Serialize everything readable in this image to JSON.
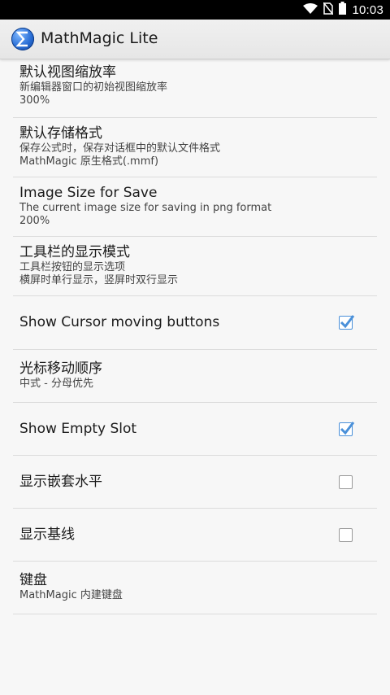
{
  "status_bar": {
    "time": "10:03",
    "icons": [
      "wifi-icon",
      "no-sim-icon",
      "battery-icon"
    ]
  },
  "app_bar": {
    "title": "MathMagic Lite",
    "icon": "sigma-app-icon"
  },
  "settings": [
    {
      "title": "默认视图缩放率",
      "summary": "新编辑器窗口的初始视图缩放率",
      "value": "300%"
    },
    {
      "title": "默认存储格式",
      "summary": "保存公式时，保存对话框中的默认文件格式",
      "value": "MathMagic 原生格式(.mmf)"
    },
    {
      "title": "Image Size for Save",
      "summary": "The current image size for saving in png format",
      "value": "200%"
    },
    {
      "title": "工具栏的显示模式",
      "summary": "工具栏按钮的显示选项",
      "value": "横屏时单行显示，竖屏时双行显示"
    },
    {
      "title": "Show Cursor moving buttons",
      "checked": true
    },
    {
      "title": "光标移动顺序",
      "value": "中式 - 分母优先"
    },
    {
      "title": "Show Empty Slot",
      "checked": true
    },
    {
      "title": "显示嵌套水平",
      "checked": false
    },
    {
      "title": "显示基线",
      "checked": false
    },
    {
      "title": "键盘",
      "value": "MathMagic 内建键盘"
    }
  ],
  "colors": {
    "accent": "#4a90d9",
    "status_bar": "#000000",
    "app_bar": "#ececec"
  }
}
